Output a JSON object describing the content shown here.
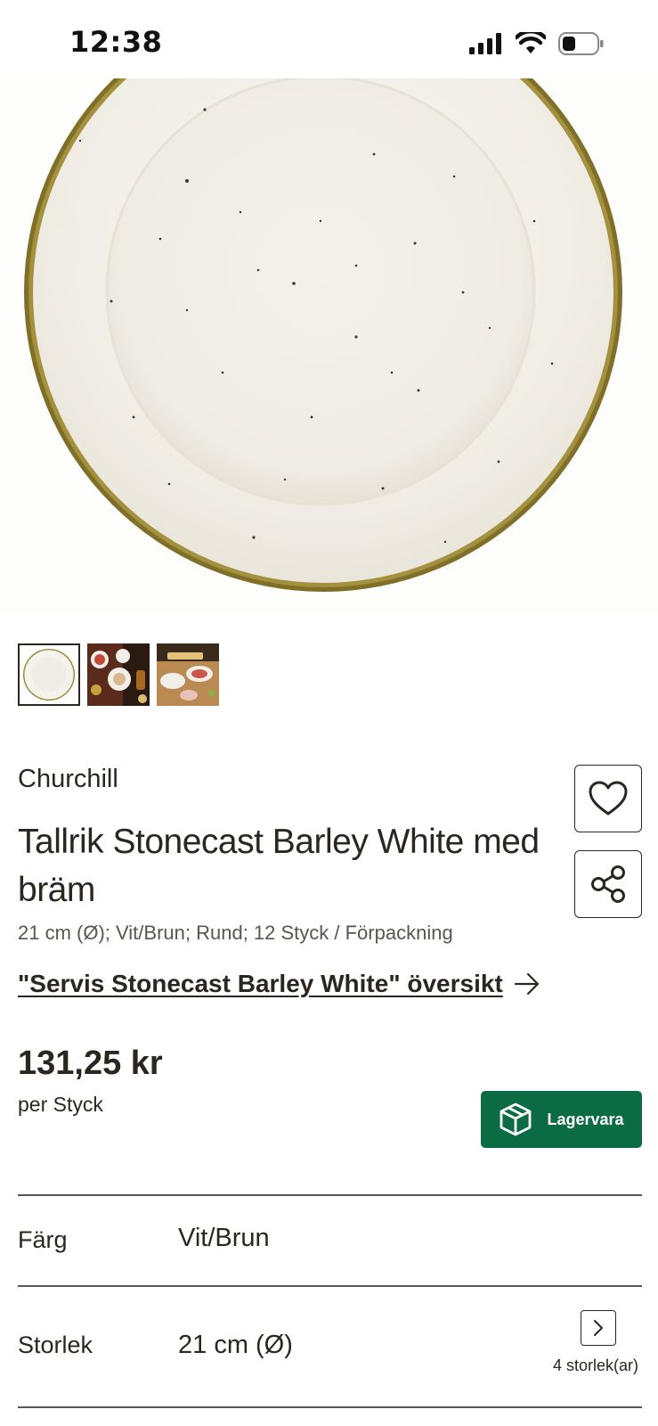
{
  "status_bar": {
    "time": "12:38"
  },
  "product": {
    "brand": "Churchill",
    "title": "Tallrik Stonecast Barley White med bräm",
    "specs": "21 cm (Ø); Vit/Brun; Rund; 12 Styck / Förpackning",
    "series_link": "\"Servis Stonecast Barley White\" översikt",
    "price": "131,25 kr",
    "per_unit": "per Styck",
    "stock_label": "Lagervara"
  },
  "gallery": {
    "thumbnails": [
      {
        "name": "plate-white"
      },
      {
        "name": "table-setting-dark"
      },
      {
        "name": "table-setting-wood"
      }
    ]
  },
  "attributes": {
    "color_label": "Färg",
    "color_value": "Vit/Brun",
    "size_label": "Storlek",
    "size_value": "21 cm (Ø)",
    "size_count": "4 storlek(ar)"
  },
  "colors": {
    "brand_green": "#0b6b42",
    "text": "#2b2620",
    "rim": "#8a7a2e"
  },
  "icons": [
    "signal-icon",
    "wifi-icon",
    "battery-icon",
    "heart-icon",
    "share-icon",
    "arrow-right-icon",
    "box-icon",
    "chevron-right-icon"
  ]
}
